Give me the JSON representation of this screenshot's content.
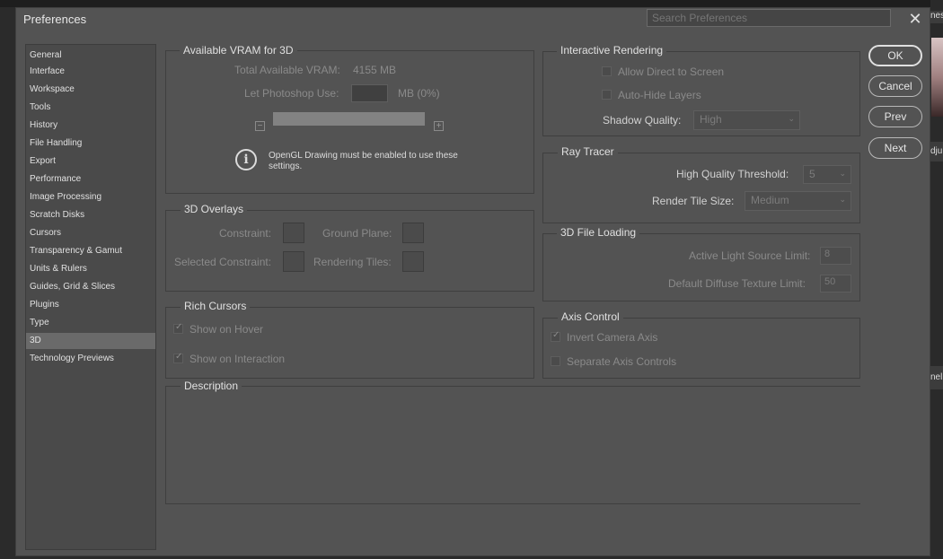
{
  "dialog": {
    "title": "Preferences",
    "search_placeholder": "Search Preferences",
    "close_label": "✕"
  },
  "sidebar": {
    "items": [
      {
        "label": "General"
      },
      {
        "label": "Interface"
      },
      {
        "label": "Workspace"
      },
      {
        "label": "Tools"
      },
      {
        "label": "History"
      },
      {
        "label": "File Handling"
      },
      {
        "label": "Export"
      },
      {
        "label": "Performance"
      },
      {
        "label": "Image Processing"
      },
      {
        "label": "Scratch Disks"
      },
      {
        "label": "Cursors"
      },
      {
        "label": "Transparency & Gamut"
      },
      {
        "label": "Units & Rulers"
      },
      {
        "label": "Guides, Grid & Slices"
      },
      {
        "label": "Plugins"
      },
      {
        "label": "Type"
      },
      {
        "label": "3D"
      },
      {
        "label": "Technology Previews"
      }
    ],
    "active": "3D"
  },
  "vram": {
    "title": "Available VRAM for 3D",
    "total_label": "Total Available VRAM:",
    "total_value": "4155 MB",
    "let_label": "Let Photoshop Use:",
    "let_unit": "MB (0%)",
    "minus": "−",
    "plus": "+",
    "info_glyph": "i",
    "info_text": "OpenGL Drawing must be enabled to use these settings."
  },
  "overlays": {
    "title": "3D Overlays",
    "constraint": "Constraint:",
    "ground_plane": "Ground Plane:",
    "selected_constraint": "Selected Constraint:",
    "rendering_tiles": "Rendering Tiles:"
  },
  "rich_cursors": {
    "title": "Rich Cursors",
    "show_hover": "Show on Hover",
    "show_interaction": "Show on Interaction",
    "show_hover_checked": true,
    "show_interaction_checked": true
  },
  "interactive": {
    "title": "Interactive Rendering",
    "allow_direct": "Allow Direct to Screen",
    "auto_hide": "Auto-Hide Layers",
    "allow_direct_checked": false,
    "auto_hide_checked": false,
    "shadow_label": "Shadow Quality:",
    "shadow_value": "High"
  },
  "ray_tracer": {
    "title": "Ray Tracer",
    "hq_label": "High Quality Threshold:",
    "hq_value": "5",
    "tile_label": "Render Tile Size:",
    "tile_value": "Medium"
  },
  "file_loading": {
    "title": "3D File Loading",
    "light_label": "Active Light Source Limit:",
    "light_value": "8",
    "texture_label": "Default Diffuse Texture Limit:",
    "texture_value": "50"
  },
  "axis": {
    "title": "Axis Control",
    "invert": "Invert Camera Axis",
    "separate": "Separate Axis Controls",
    "invert_checked": true,
    "separate_checked": false
  },
  "description": {
    "title": "Description"
  },
  "buttons": {
    "ok": "OK",
    "cancel": "Cancel",
    "prev": "Prev",
    "next": "Next"
  },
  "background_app": {
    "tab_top": "nes",
    "tab_mid": "dju",
    "tab_low": "nel"
  }
}
